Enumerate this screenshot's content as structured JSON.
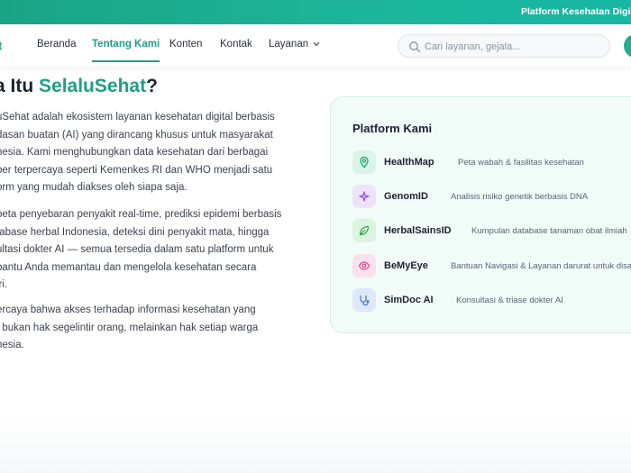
{
  "topbar": {
    "text": "Platform Kesehatan Digital Indo"
  },
  "logo": {
    "fragment": "t"
  },
  "nav": {
    "items": [
      {
        "label": "Beranda",
        "active": false
      },
      {
        "label": "Tentang Kami",
        "active": true
      },
      {
        "label": "Konten",
        "active": false
      },
      {
        "label": "Kontak",
        "active": false
      },
      {
        "label": "Layanan",
        "active": false
      }
    ]
  },
  "search": {
    "placeholder": "Cari layanan, gejala..."
  },
  "hero": {
    "title_prefix": "a Itu ",
    "title_brand": "SelaluSehat",
    "title_suffix": "?"
  },
  "about": {
    "paragraphs": [
      [
        "uSehat adalah ekosistem layanan kesehatan digital berbasis",
        "dasan buatan (AI) yang dirancang khusus untuk masyarakat",
        "nesia. Kami menghubungkan data kesehatan dari berbagai",
        "ber terpercaya seperti Kemenkes RI dan WHO menjadi satu",
        "orm yang mudah diakses oleh siapa saja."
      ],
      [
        "peta penyebaran penyakit real-time, prediksi epidemi berbasis",
        "tabase herbal Indonesia, deteksi dini penyakit mata, hingga",
        "ultasi dokter AI — semua tersedia dalam satu platform untuk",
        "bantu Anda memantau dan mengelola kesehatan secara",
        "iri."
      ],
      [
        "ercaya bahwa akses terhadap informasi kesehatan yang",
        "t bukan hak segelintir orang, melainkan hak setiap warga",
        "nesia."
      ]
    ]
  },
  "platform": {
    "title": "Platform Kami",
    "items": [
      {
        "name": "HealthMap",
        "desc": "Peta wabah & fasilitas kesehatan",
        "icon": "map-pin-icon",
        "bg": "#d9f5ea",
        "fg": "#1e9e6a"
      },
      {
        "name": "GenomID",
        "desc": "Analisis risiko genetik berbasis DNA",
        "icon": "sparkle-icon",
        "bg": "#ece3fb",
        "fg": "#8a55e0"
      },
      {
        "name": "HerbalSainsID",
        "desc": "Kumpulan database tanaman obat ilmiah",
        "icon": "leaf-icon",
        "bg": "#dcf3df",
        "fg": "#3aa34c"
      },
      {
        "name": "BeMyEye",
        "desc": "Bantuan Navigasi & Layanan darurat untuk disabilitas",
        "icon": "eye-icon",
        "bg": "#fbe1ee",
        "fg": "#d6478c"
      },
      {
        "name": "SimDoc AI",
        "desc": "Konsultasi & triase dokter AI",
        "icon": "stethoscope-icon",
        "bg": "#dfe7fb",
        "fg": "#4a6fd8"
      }
    ]
  }
}
